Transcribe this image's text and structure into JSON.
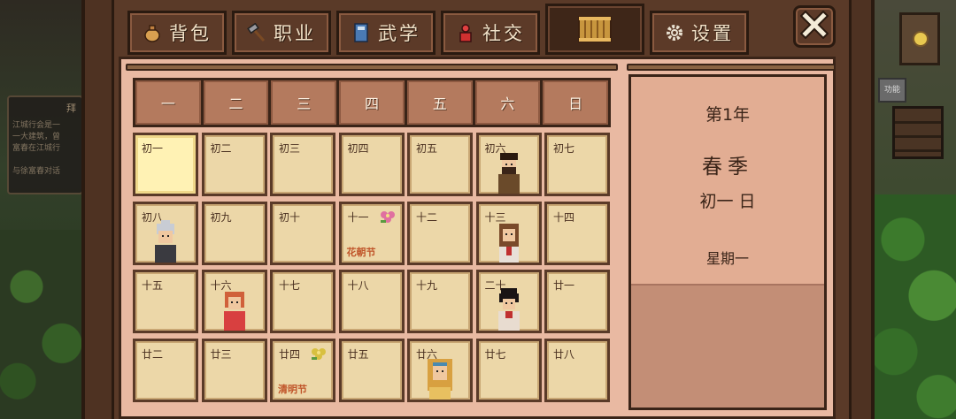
{
  "tabs": [
    {
      "label": "背包",
      "icon": "bag-icon"
    },
    {
      "label": "职业",
      "icon": "hammer-icon"
    },
    {
      "label": "武学",
      "icon": "book-icon"
    },
    {
      "label": "社交",
      "icon": "person-icon"
    },
    {
      "label": "",
      "icon": "calendar-icon",
      "active": true
    },
    {
      "label": "设置",
      "icon": "gear-icon"
    }
  ],
  "weekdays": [
    "一",
    "二",
    "三",
    "四",
    "五",
    "六",
    "日"
  ],
  "days": [
    {
      "label": "初一",
      "today": true
    },
    {
      "label": "初二"
    },
    {
      "label": "初三"
    },
    {
      "label": "初四"
    },
    {
      "label": "初五"
    },
    {
      "label": "初六",
      "npc": "bearded-man-portrait"
    },
    {
      "label": "初七"
    },
    {
      "label": "初八",
      "npc": "old-woman-portrait"
    },
    {
      "label": "初九"
    },
    {
      "label": "初十"
    },
    {
      "label": "十一",
      "festival": "花朝节",
      "icon": "flower-icon"
    },
    {
      "label": "十二"
    },
    {
      "label": "十三",
      "npc": "brown-hair-woman-portrait"
    },
    {
      "label": "十四"
    },
    {
      "label": "十五"
    },
    {
      "label": "十六",
      "npc": "red-hair-girl-portrait"
    },
    {
      "label": "十七"
    },
    {
      "label": "十八"
    },
    {
      "label": "十九"
    },
    {
      "label": "二十",
      "npc": "black-hair-woman-portrait"
    },
    {
      "label": "廿一"
    },
    {
      "label": "廿二"
    },
    {
      "label": "廿三"
    },
    {
      "label": "廿四",
      "festival": "清明节",
      "icon": "flower-icon"
    },
    {
      "label": "廿五"
    },
    {
      "label": "廿六",
      "npc": "blonde-hooded-woman-portrait"
    },
    {
      "label": "廿七"
    },
    {
      "label": "廿八"
    }
  ],
  "info": {
    "year": "第1年",
    "season": "春季",
    "date": "初一 日",
    "weekday": "星期一"
  },
  "background": {
    "sign_title": "拜",
    "sign_text": "江城行会是一\n一大建筑，曾\n富春在江城行\n\n与徐富春对话",
    "mini_label": "功能"
  },
  "colors": {
    "frame": "#5a3a28",
    "panel": "#e9b9a2",
    "day_cell": "#ecd7a8",
    "today_cell": "#fff2b4",
    "festival_text": "#c0552a",
    "header_cell": "#b47a5e"
  }
}
